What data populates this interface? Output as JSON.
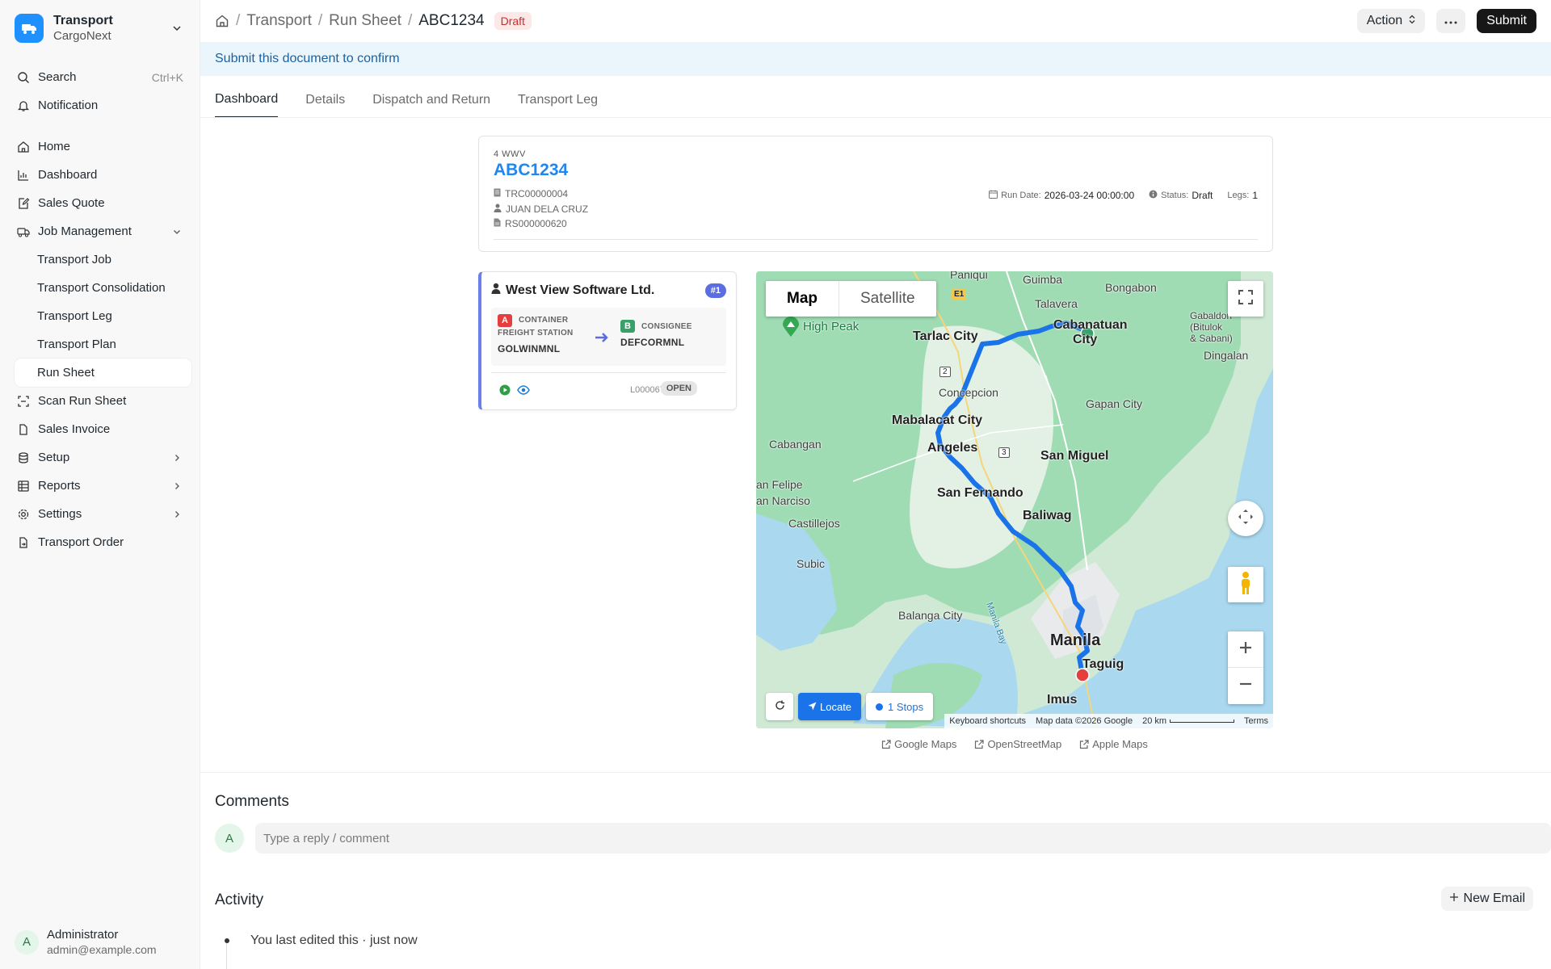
{
  "app": {
    "name": "Transport",
    "company": "CargoNext",
    "brand_color": "#1e90ff"
  },
  "sidebar": {
    "search_label": "Search",
    "search_shortcut": "Ctrl+K",
    "notification_label": "Notification",
    "items": [
      {
        "label": "Home",
        "icon": "home-icon"
      },
      {
        "label": "Dashboard",
        "icon": "chart-icon"
      },
      {
        "label": "Sales Quote",
        "icon": "edit-doc-icon"
      },
      {
        "label": "Job Management",
        "icon": "truck-icon"
      },
      {
        "label": "Transport Job"
      },
      {
        "label": "Transport Consolidation"
      },
      {
        "label": "Transport Leg"
      },
      {
        "label": "Transport Plan"
      },
      {
        "label": "Run Sheet"
      },
      {
        "label": "Scan Run Sheet",
        "icon": "scan-icon"
      },
      {
        "label": "Sales Invoice",
        "icon": "file-icon"
      },
      {
        "label": "Setup",
        "icon": "database-icon"
      },
      {
        "label": "Reports",
        "icon": "table-icon"
      },
      {
        "label": "Settings",
        "icon": "gear-icon"
      },
      {
        "label": "Transport Order",
        "icon": "file-arrow-icon"
      }
    ],
    "user": {
      "initial": "A",
      "name": "Administrator",
      "email": "admin@example.com"
    }
  },
  "header": {
    "breadcrumbs": [
      "Transport",
      "Run Sheet",
      "ABC1234"
    ],
    "status": "Draft",
    "action_label": "Action",
    "submit_label": "Submit"
  },
  "banner": "Submit this document to confirm",
  "tabs": [
    "Dashboard",
    "Details",
    "Dispatch and Return",
    "Transport Leg"
  ],
  "run_sheet": {
    "vehicle_model": "4 WWV",
    "id": "ABC1234",
    "ref": "TRC00000004",
    "driver": "JUAN DELA CRUZ",
    "doc": "RS000000620",
    "run_date_label": "Run Date:",
    "run_date": "2026-03-24 00:00:00",
    "status_label": "Status:",
    "status": "Draft",
    "legs_label": "Legs:",
    "legs": "1"
  },
  "leg": {
    "customer": "West View Software Ltd.",
    "number": "#1",
    "pickup": {
      "tag": "A",
      "type_line1": "CONTAINER",
      "type_line2": "FREIGHT STATION",
      "code": "GOLWINMNL",
      "color": "#e53e3e"
    },
    "drop": {
      "tag": "B",
      "type": "CONSIGNEE",
      "code": "DEFCORMNL",
      "color": "#38a169"
    },
    "leg_id": "L0000671",
    "status": "OPEN"
  },
  "map": {
    "map_type_on": "Map",
    "map_type_off": "Satellite",
    "labels": [
      "Paniqui",
      "Guimba",
      "Bongabon",
      "Talavera",
      "Cabanatuan",
      "City",
      "Gabaldon",
      "(Bitulok",
      "& Sabani)",
      "High Peak",
      "Tarlac City",
      "Dingalan",
      "Concepcion",
      "Gapan City",
      "Mabalacat City",
      "Cabangan",
      "Angeles",
      "San Miguel",
      "an Felipe",
      "San Fernando",
      "an Narciso",
      "Baliwag",
      "Castillejos",
      "Subic",
      "Balanga City",
      "Manila Bay",
      "Manila",
      "Taguig",
      "Imus"
    ],
    "road_shields": [
      "E1",
      "2",
      "3"
    ],
    "locate_label": "Locate",
    "stops_label": "1 Stops",
    "attribution": [
      "Keyboard shortcuts",
      "Map data ©2026 Google",
      "20 km",
      "Terms"
    ],
    "route_color": "#1a73e8"
  },
  "map_links": [
    "Google Maps",
    "OpenStreetMap",
    "Apple Maps"
  ],
  "comments": {
    "title": "Comments",
    "avatar": "A",
    "placeholder": "Type a reply / comment"
  },
  "activity": {
    "title": "Activity",
    "new_email": "New Email",
    "items": [
      "You last edited this · just now"
    ]
  }
}
